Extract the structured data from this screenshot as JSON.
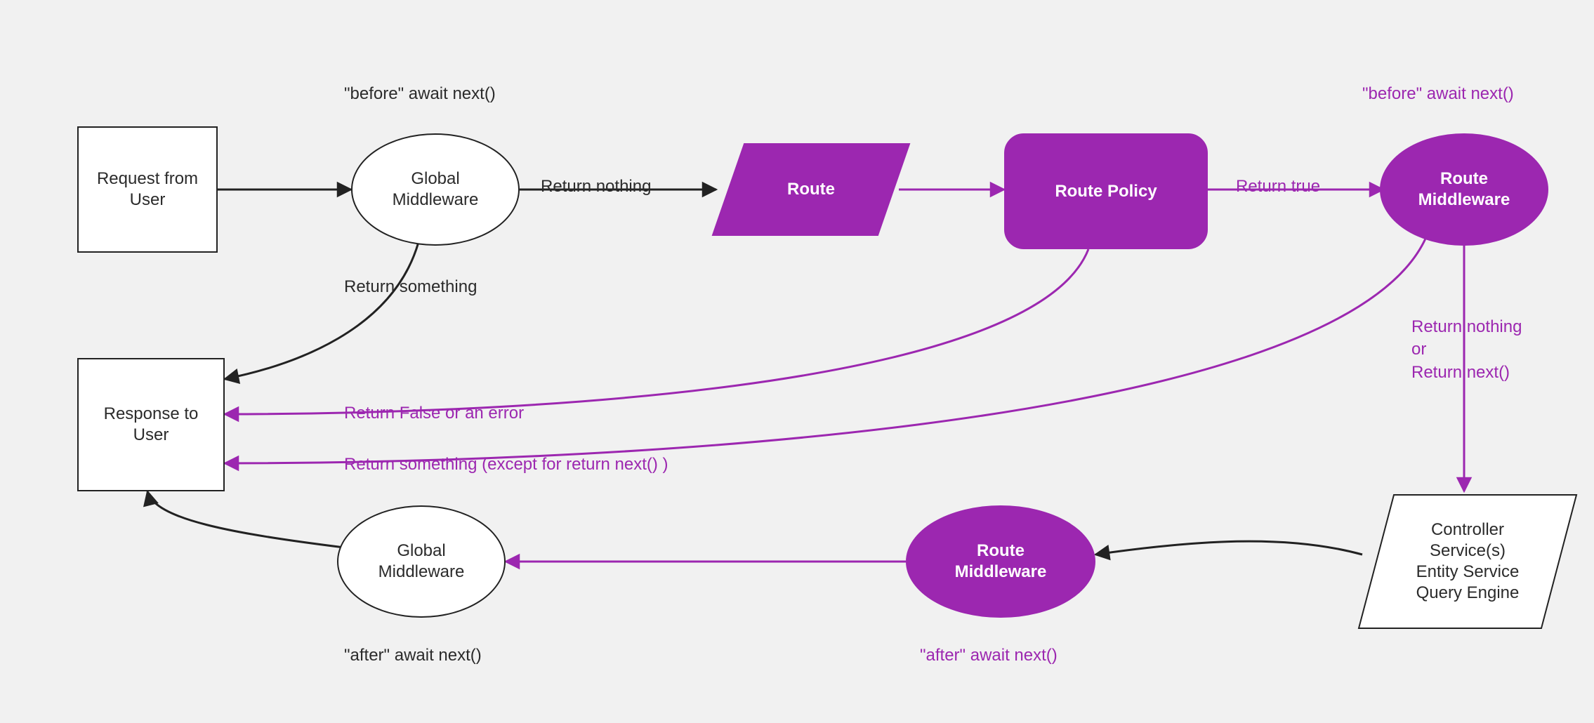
{
  "colors": {
    "bg": "#f1f1f1",
    "stroke_dark": "#222222",
    "stroke_purple": "#9c27b0",
    "fill_purple": "#9c27b0",
    "text_dark": "#2b2b2b",
    "text_purple": "#9c27b0",
    "node_bg": "#ffffff"
  },
  "nodes": {
    "request_from_user": "Request from\nUser",
    "global_middleware_top": "Global\nMiddleware",
    "before_await_next_top": "\"before\" await next()",
    "return_nothing_edge": "Return nothing",
    "route": "Route",
    "route_policy": "Route Policy",
    "return_true_edge": "Return true",
    "route_middleware_top": "Route\nMiddleware",
    "before_await_next_right": "\"before\" await next()",
    "return_nothing_or_next": "Return nothing\nor\nReturn next()",
    "controller_stack": "Controller\nService(s)\nEntity Service\nQuery Engine",
    "route_middleware_bottom": "Route\nMiddleware",
    "after_await_next_right": "\"after\" await next()",
    "global_middleware_bottom": "Global\nMiddleware",
    "after_await_next_left": "\"after\" await next()",
    "response_to_user": "Response to\nUser",
    "return_something_edge": "Return something",
    "return_false_error_edge": "Return False or an error",
    "return_something_except_next_edge": "Return something (except for return next() )"
  },
  "diagram": {
    "flow": [
      {
        "from": "request_from_user",
        "to": "global_middleware_top",
        "label": null,
        "color": "dark"
      },
      {
        "from": "global_middleware_top",
        "to": "route",
        "label": "return_nothing_edge",
        "color": "dark_then_purple_arrowhead"
      },
      {
        "from": "global_middleware_top",
        "to": "response_to_user",
        "label": "return_something_edge",
        "color": "dark"
      },
      {
        "from": "route",
        "to": "route_policy",
        "label": null,
        "color": "purple"
      },
      {
        "from": "route_policy",
        "to": "route_middleware_top",
        "label": "return_true_edge",
        "color": "purple"
      },
      {
        "from": "route_policy",
        "to": "response_to_user",
        "label": "return_false_error_edge",
        "color": "purple"
      },
      {
        "from": "route_middleware_top",
        "to": "controller_stack",
        "label": "return_nothing_or_next",
        "color": "purple"
      },
      {
        "from": "route_middleware_top",
        "to": "response_to_user",
        "label": "return_something_except_next_edge",
        "color": "purple"
      },
      {
        "from": "controller_stack",
        "to": "route_middleware_bottom",
        "label": null,
        "color": "dark"
      },
      {
        "from": "route_middleware_bottom",
        "to": "global_middleware_bottom",
        "label": null,
        "color": "purple"
      },
      {
        "from": "global_middleware_bottom",
        "to": "response_to_user",
        "label": null,
        "color": "dark"
      }
    ],
    "annotations": [
      {
        "node": "global_middleware_top",
        "text_key": "before_await_next_top",
        "position": "above"
      },
      {
        "node": "route_middleware_top",
        "text_key": "before_await_next_right",
        "position": "above",
        "color": "purple"
      },
      {
        "node": "route_middleware_bottom",
        "text_key": "after_await_next_right",
        "position": "below",
        "color": "purple"
      },
      {
        "node": "global_middleware_bottom",
        "text_key": "after_await_next_left",
        "position": "below"
      }
    ]
  }
}
